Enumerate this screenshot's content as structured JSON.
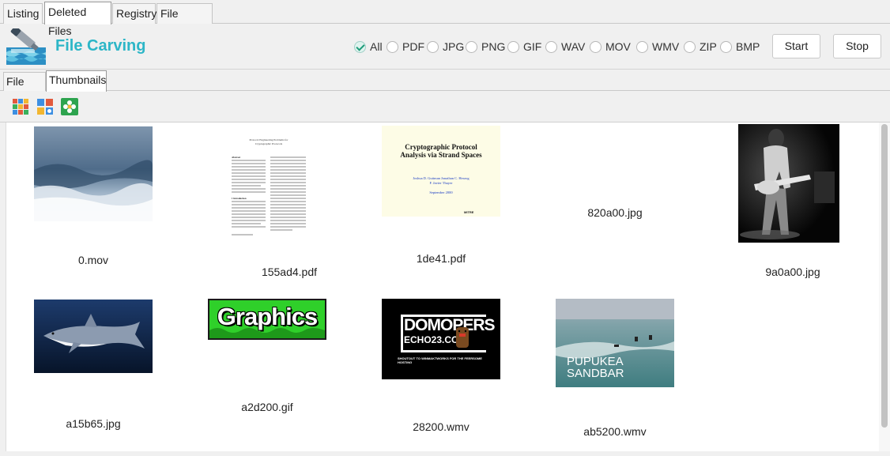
{
  "top_tabs": [
    "Listing",
    "Deleted Files",
    "Registry",
    "File Search"
  ],
  "header": {
    "title": "File Carving",
    "filters": [
      "All",
      "PDF",
      "JPG",
      "PNG",
      "GIF",
      "WAV",
      "MOV",
      "WMV",
      "ZIP",
      "BMP"
    ],
    "selected_filter": "All",
    "start_label": "Start",
    "stop_label": "Stop"
  },
  "sub_tabs": [
    "File List",
    "Thumbnails"
  ],
  "toolbar": {
    "icons": [
      "large-grid-view-icon",
      "small-grid-view-icon",
      "settings-flower-icon"
    ]
  },
  "thumbnails": [
    {
      "filename": "0.mov"
    },
    {
      "filename": "155ad4.pdf",
      "doc_title": "Protocol Engineering Problems for Cryptographic Protocols",
      "doc_heading": "Abstract",
      "doc_section": "1  Introduction"
    },
    {
      "filename": "1de41.pdf",
      "doc_title": "Cryptographic Protocol Analysis via Strand Spaces",
      "doc_authors": "Joshua D. Guttman Jonathan C. Herzog F. Javier Thayer",
      "doc_date": "September 2000",
      "doc_org": "MITRE"
    },
    {
      "filename": "820a00.jpg"
    },
    {
      "filename": "9a0a00.jpg"
    },
    {
      "filename": "a15b65.jpg"
    },
    {
      "filename": "a2d200.gif",
      "image_text": "Graphics"
    },
    {
      "filename": "28200.wmv",
      "image_text": "DOMOPERS",
      "image_subtext": "ECHO23.COM",
      "image_footer": "SHOUTOUT TO WINMAKTWORKS FOR THE FEERSOME HOSTING"
    },
    {
      "filename": "ab5200.wmv",
      "image_text": "PUPUKEA SANDBAR"
    }
  ],
  "colors": {
    "accent": "#2db6c7",
    "selected_check": "#1f9c7a"
  }
}
